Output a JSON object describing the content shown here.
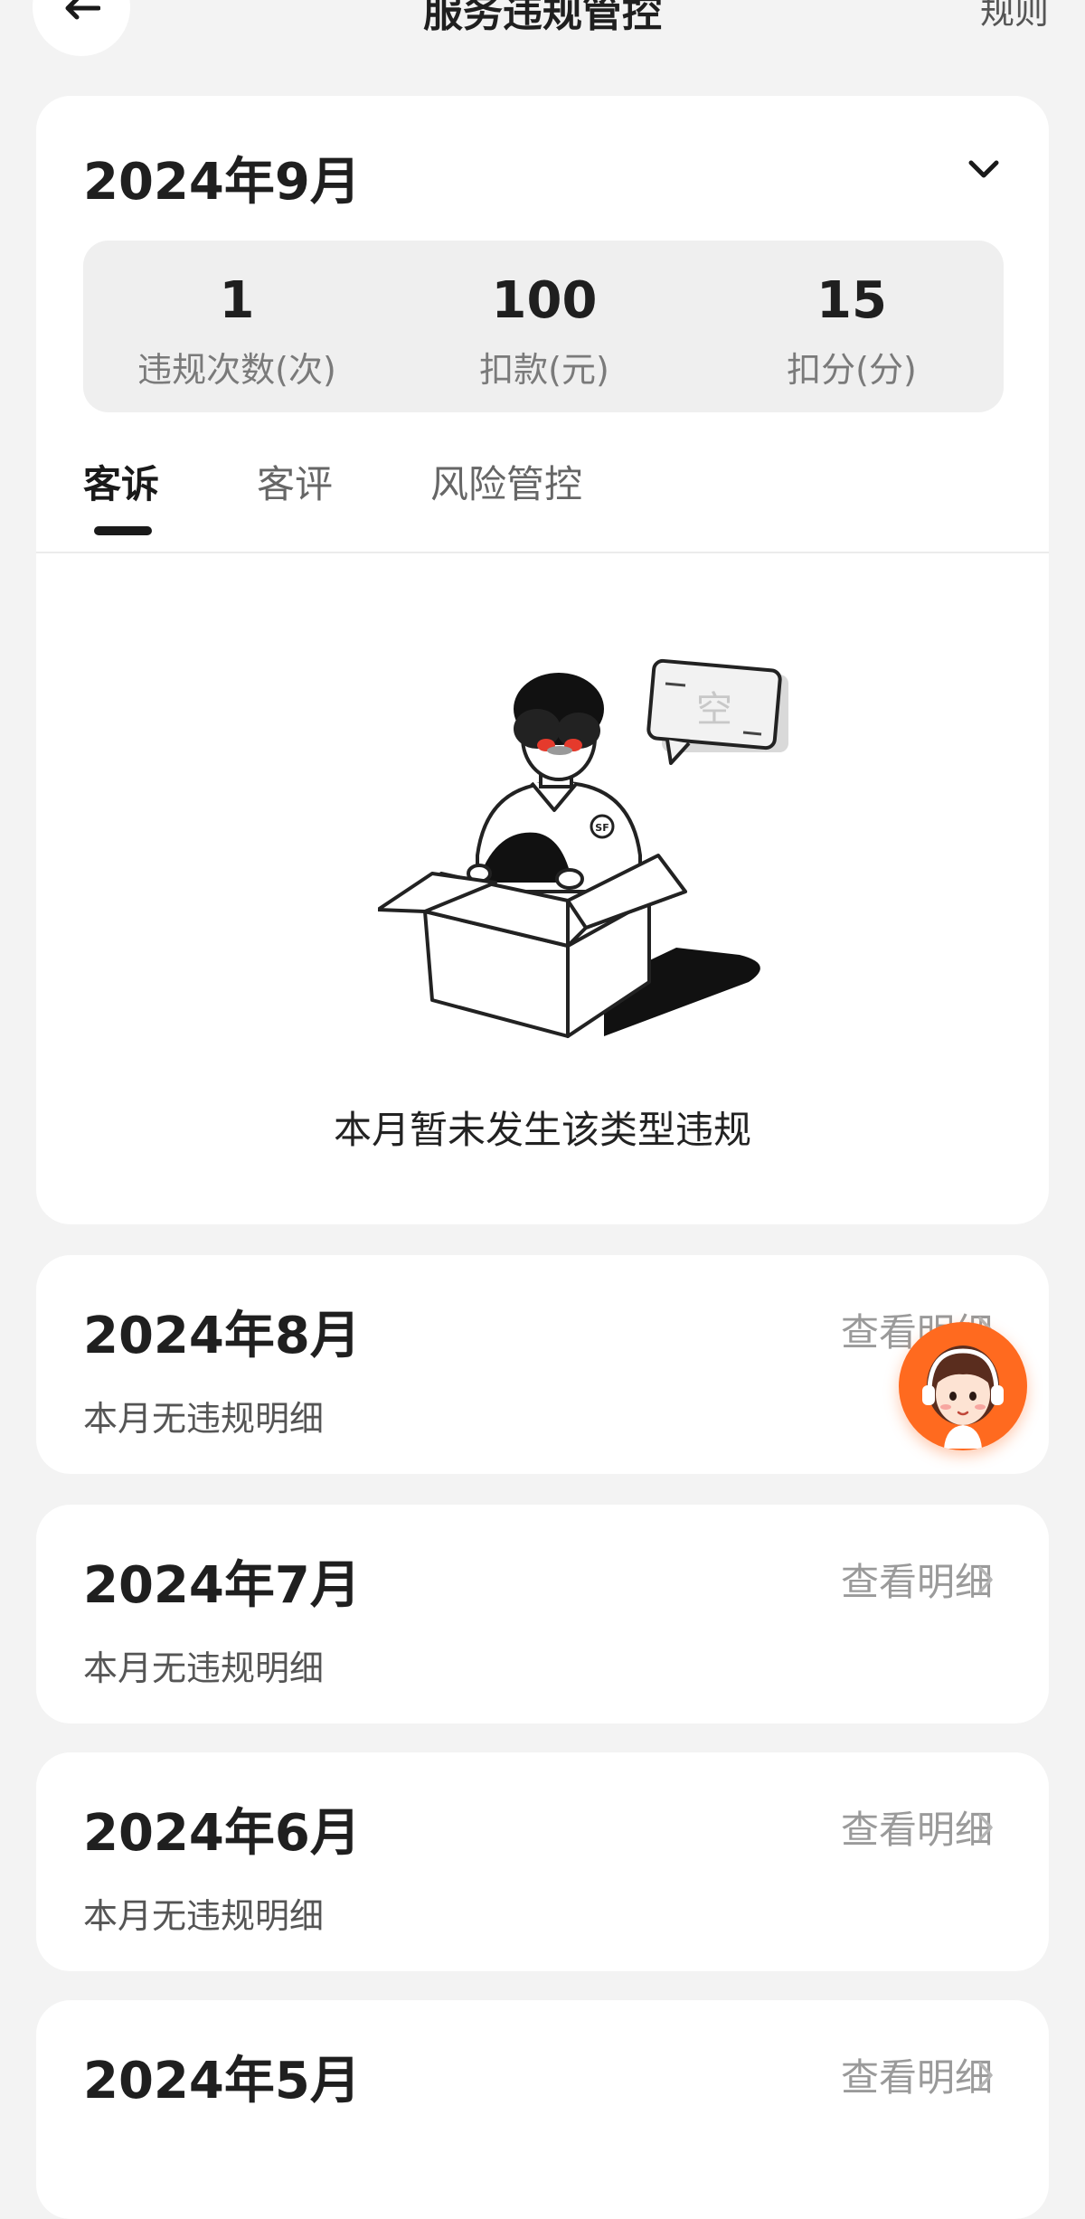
{
  "header": {
    "title": "服务违规管控",
    "rules_link": "规则"
  },
  "current_month": {
    "label": "2024年9月",
    "stats": [
      {
        "value": "1",
        "label": "违规次数(次)"
      },
      {
        "value": "100",
        "label": "扣款(元)"
      },
      {
        "value": "15",
        "label": "扣分(分)"
      }
    ],
    "tabs": [
      {
        "label": "客诉",
        "active": true
      },
      {
        "label": "客评",
        "active": false
      },
      {
        "label": "风险管控",
        "active": false
      }
    ],
    "empty_state": {
      "badge_text": "空",
      "message": "本月暂未发生该类型违规"
    }
  },
  "months": [
    {
      "label": "2024年8月",
      "detail_link": "查看明细",
      "subtitle": "本月无违规明细"
    },
    {
      "label": "2024年7月",
      "detail_link": "查看明细",
      "subtitle": "本月无违规明细"
    },
    {
      "label": "2024年6月",
      "detail_link": "查看明细",
      "subtitle": "本月无违规明细"
    },
    {
      "label": "2024年5月",
      "detail_link": "查看明细",
      "subtitle": ""
    }
  ],
  "icons": {
    "back": "arrow-left-icon",
    "expand": "chevron-down-icon",
    "detail": "chevron-right-icon",
    "service": "customer-service-avatar-icon"
  },
  "colors": {
    "page_bg": "#f3f3f3",
    "card_bg": "#ffffff",
    "stats_bg": "#efefef",
    "accent_orange": "#ff6a1f"
  }
}
